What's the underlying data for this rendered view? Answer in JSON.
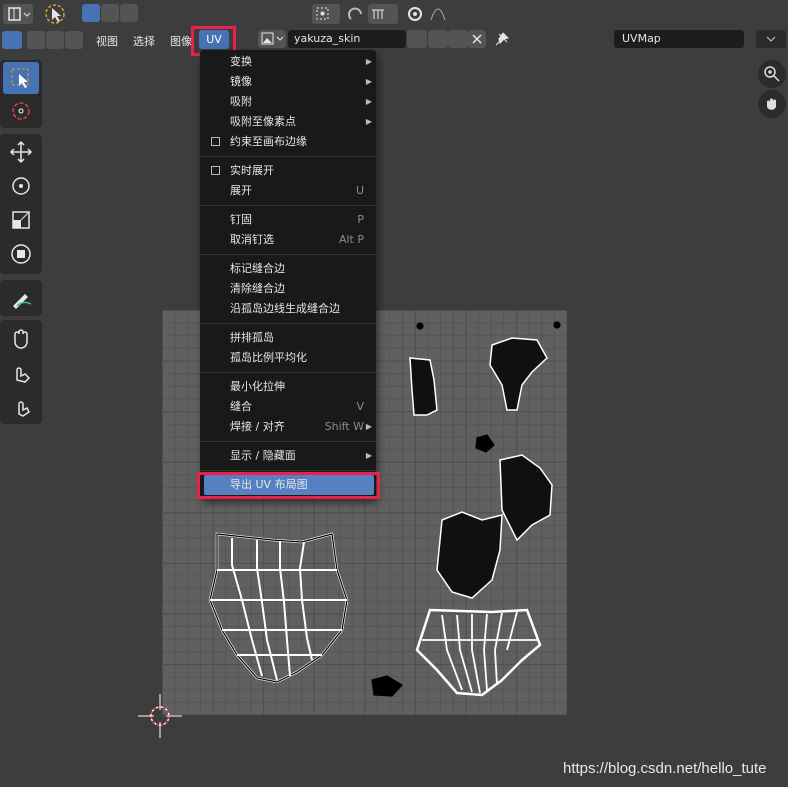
{
  "header": {
    "menus": [
      "视图",
      "选择",
      "图像"
    ],
    "uv_menu": "UV",
    "image_name": "yakuza_skin",
    "uv_map": "UVMap"
  },
  "uv_menu": {
    "items": [
      {
        "label": "变换",
        "submenu": true
      },
      {
        "label": "镜像",
        "submenu": true
      },
      {
        "label": "吸附",
        "submenu": true
      },
      {
        "label": "吸附至像素点",
        "submenu": true
      },
      {
        "label": "约束至画布边缘",
        "checkbox": true
      },
      {
        "label": "实时展开",
        "checkbox": true
      },
      {
        "label": "展开",
        "shortcut": "U"
      },
      {
        "label": "钉固",
        "shortcut": "P"
      },
      {
        "label": "取消钉选",
        "shortcut": "Alt P"
      },
      {
        "label": "标记缝合边"
      },
      {
        "label": "清除缝合边"
      },
      {
        "label": "沿孤岛边线生成缝合边"
      },
      {
        "label": "拼排孤岛"
      },
      {
        "label": "孤岛比例平均化"
      },
      {
        "label": "最小化拉伸"
      },
      {
        "label": "缝合",
        "shortcut": "V"
      },
      {
        "label": "焊接 / 对齐",
        "shortcut": "Shift W",
        "submenu": true
      },
      {
        "label": "显示 / 隐藏面",
        "submenu": true
      },
      {
        "label": "导出 UV 布局图",
        "highlighted": true
      }
    ]
  },
  "watermark": "https://blog.csdn.net/hello_tute",
  "colors": {
    "accent": "#4772b3",
    "highlight_box": "#e8224a",
    "menu_bg": "#191919"
  }
}
